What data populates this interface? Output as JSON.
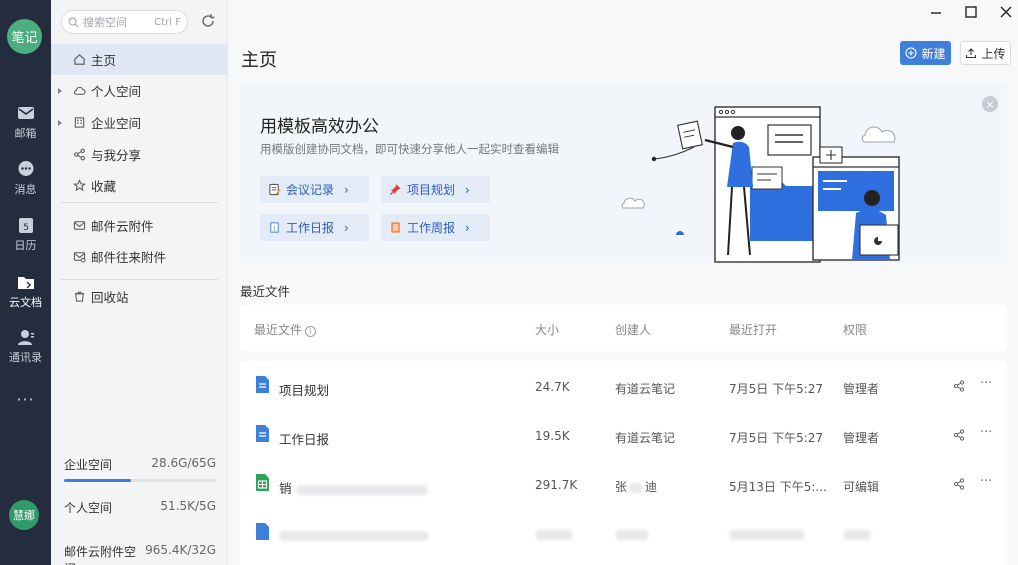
{
  "rail": {
    "logo": "笔记",
    "items": [
      {
        "label": "邮箱",
        "icon": "mail-icon"
      },
      {
        "label": "消息",
        "icon": "chat-icon"
      },
      {
        "label": "日历",
        "icon": "calendar-icon",
        "day": "5"
      },
      {
        "label": "云文档",
        "icon": "folder-icon"
      },
      {
        "label": "通讯录",
        "icon": "contacts-icon"
      }
    ],
    "more": "···",
    "avatar": "慧娜"
  },
  "sidebar": {
    "search_placeholder": "搜索空间",
    "search_shortcut": "Ctrl F",
    "nav": [
      {
        "label": "主页",
        "icon": "home-icon"
      },
      {
        "label": "个人空间",
        "icon": "cloud-icon"
      },
      {
        "label": "企业空间",
        "icon": "building-icon"
      },
      {
        "label": "与我分享",
        "icon": "share-icon"
      },
      {
        "label": "收藏",
        "icon": "star-icon"
      },
      {
        "label": "邮件云附件",
        "icon": "mail-attachment-icon"
      },
      {
        "label": "邮件往来附件",
        "icon": "mail-exchange-icon"
      },
      {
        "label": "回收站",
        "icon": "trash-icon"
      }
    ],
    "quota": [
      {
        "label": "企业空间",
        "value": "28.6G/65G",
        "fill": 0.44
      },
      {
        "label": "个人空间",
        "value": "51.5K/5G"
      },
      {
        "label": "邮件云附件空间",
        "value": "965.4K/32G"
      }
    ]
  },
  "header": {
    "title": "主页",
    "new_label": "新建",
    "upload_label": "上传"
  },
  "banner": {
    "title": "用模板高效办公",
    "subtitle": "用模版创建协同文档，即可快速分享他人一起实时查看编辑",
    "templates": [
      {
        "label": "会议记录",
        "icon": "note-icon"
      },
      {
        "label": "项目规划",
        "icon": "pin-icon"
      },
      {
        "label": "工作日报",
        "icon": "daily-icon"
      },
      {
        "label": "工作周报",
        "icon": "weekly-icon"
      }
    ],
    "close": "×"
  },
  "recent": {
    "section_title": "最近文件",
    "columns": [
      "最近文件",
      "大小",
      "创建人",
      "最近打开",
      "权限"
    ],
    "info": "i",
    "rows": [
      {
        "name": "项目规划",
        "size": "24.7K",
        "creator": "有道云笔记",
        "opened": "7月5日 下午5:27",
        "perm": "管理者",
        "type": "doc"
      },
      {
        "name": "工作日报",
        "size": "19.5K",
        "creator": "有道云笔记",
        "opened": "7月5日 下午5:27",
        "perm": "管理者",
        "type": "doc"
      },
      {
        "name": "销",
        "size": "291.7K",
        "creator": "张",
        "creator_tail": "迪",
        "opened": "5月13日 下午5:...",
        "perm": "可编辑",
        "type": "sheet"
      }
    ],
    "more": "···"
  }
}
